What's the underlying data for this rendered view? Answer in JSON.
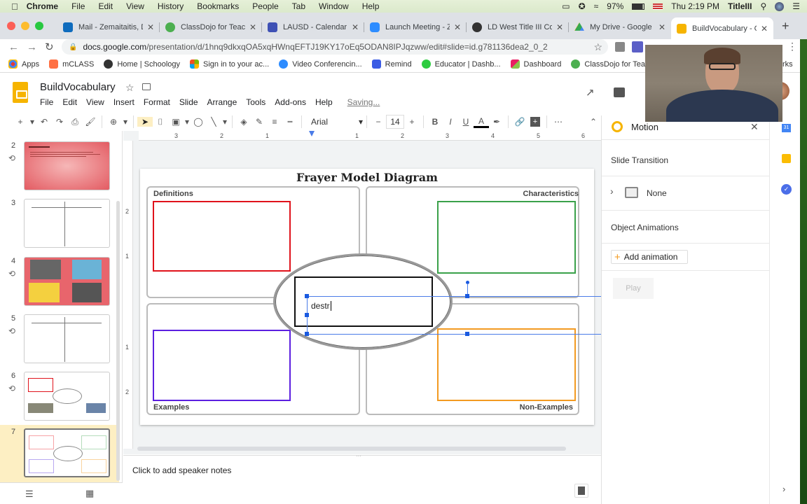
{
  "menubar": {
    "app": "Chrome",
    "items": [
      "File",
      "Edit",
      "View",
      "History",
      "Bookmarks",
      "People",
      "Tab",
      "Window",
      "Help"
    ],
    "battery": "97%",
    "clock": "Thu 2:19 PM",
    "user": "TitleIII"
  },
  "tabs": [
    {
      "title": "Mail - Zemaitaitis, D",
      "color": "#0f6cbd"
    },
    {
      "title": "ClassDojo for Teach",
      "color": "#4caf50"
    },
    {
      "title": "LAUSD - Calendar -",
      "color": "#3f51b5"
    },
    {
      "title": "Launch Meeting - Z",
      "color": "#2d8cff"
    },
    {
      "title": "LD West Title III Co",
      "color": "#333333"
    },
    {
      "title": "My Drive - Google D",
      "color": "#fbbc04"
    },
    {
      "title": "BuildVocabulary - G",
      "color": "#f6b400",
      "active": true
    }
  ],
  "address": {
    "host": "docs.google.com",
    "path": "/presentation/d/1hnq9dkxqOA5xqHWnqEFTJ19KY17oEq5ODAN8IPJqzww/edit#slide=id.g781136dea2_0_2"
  },
  "bookmarks": [
    {
      "label": "Apps",
      "color": "#e53935"
    },
    {
      "label": "mCLASS",
      "color": "#ff7043"
    },
    {
      "label": "Home | Schoology",
      "color": "#333333"
    },
    {
      "label": "Sign in to your ac...",
      "color": "#f25022"
    },
    {
      "label": "Video Conferencin...",
      "color": "#2d8cff"
    },
    {
      "label": "Remind",
      "color": "#3b5ce4"
    },
    {
      "label": "Educator | Dashb...",
      "color": "#2ecc40"
    },
    {
      "label": "Dashboard",
      "color": "#e91e63"
    },
    {
      "label": "ClassDojo for Tea...",
      "color": "#4caf50"
    }
  ],
  "bookmarks_overflow": "rks",
  "doc": {
    "title": "BuildVocabulary",
    "menus": [
      "File",
      "Edit",
      "View",
      "Insert",
      "Format",
      "Slide",
      "Arrange",
      "Tools",
      "Add-ons",
      "Help"
    ],
    "status": "Saving..."
  },
  "toolbar": {
    "font": "Arial",
    "font_size": "14"
  },
  "ruler": {
    "h_ticks": [
      "3",
      "2",
      "1",
      "1",
      "2",
      "3",
      "4",
      "5",
      "6"
    ],
    "v_ticks": [
      "2",
      "1",
      "1",
      "2"
    ]
  },
  "filmstrip": [
    {
      "num": "2",
      "motion": true,
      "kind": "red-text"
    },
    {
      "num": "3",
      "motion": false,
      "kind": "tchart"
    },
    {
      "num": "4",
      "motion": true,
      "kind": "images"
    },
    {
      "num": "5",
      "motion": true,
      "kind": "tchart-text"
    },
    {
      "num": "6",
      "motion": true,
      "kind": "frayer-filled"
    },
    {
      "num": "7",
      "motion": false,
      "kind": "frayer",
      "selected": true
    }
  ],
  "slide": {
    "title": "Frayer Model Diagram",
    "quadrants": [
      {
        "label": "Definitions",
        "color": "#e0121b"
      },
      {
        "label": "Characteristics",
        "color": "#3aa14a"
      },
      {
        "label": "Examples",
        "color": "#5b1fe0"
      },
      {
        "label": "Non-Examples",
        "color": "#f39a21"
      }
    ],
    "center_text": "destr"
  },
  "notes": {
    "placeholder": "Click to add speaker notes"
  },
  "panel": {
    "title": "Motion",
    "slide_transition": "Slide Transition",
    "transition_value": "None",
    "object_animations": "Object Animations",
    "add_animation": "Add animation",
    "play": "Play"
  }
}
